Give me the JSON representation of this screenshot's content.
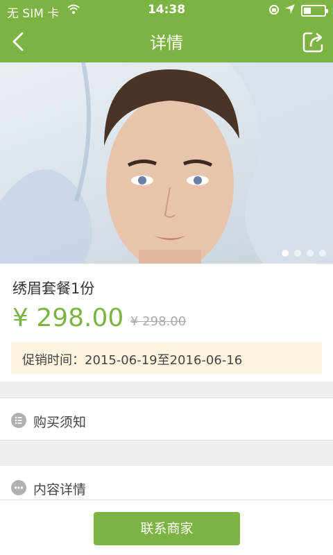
{
  "status_bar": {
    "carrier": "无 SIM 卡",
    "time": "14:38",
    "battery_level": 0.35
  },
  "nav": {
    "title": "详情"
  },
  "gallery": {
    "image_count": 4,
    "active_index": 0
  },
  "product": {
    "name": "绣眉套餐1份",
    "price": "¥ 298.00",
    "original_price": "¥ 298.00",
    "promo_text": "促销时间：2015-06-19至2016-06-16"
  },
  "sections": [
    {
      "label": "购买须知",
      "icon": "list-icon"
    },
    {
      "label": "内容详情",
      "icon": "more-icon"
    }
  ],
  "footer": {
    "contact_label": "联系商家"
  },
  "colors": {
    "accent": "#7cb342",
    "promo_bg": "#fdf5e0"
  }
}
